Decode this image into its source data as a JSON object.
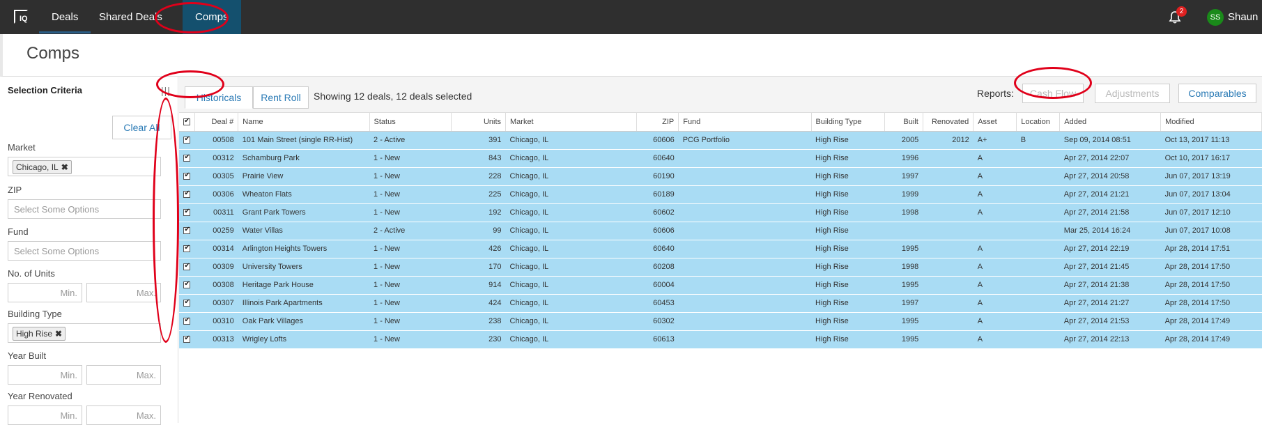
{
  "nav": {
    "logo": "IQ",
    "items": [
      "Deals",
      "Shared Deals",
      "Comps"
    ],
    "notifications": "2",
    "user_initials": "SS",
    "user_name": "Shaun"
  },
  "page": {
    "title": "Comps"
  },
  "sidebar": {
    "title": "Selection Criteria",
    "clear_all": "Clear All",
    "market_label": "Market",
    "market_tag": "Chicago, IL",
    "zip_label": "ZIP",
    "zip_placeholder": "Select Some Options",
    "fund_label": "Fund",
    "fund_placeholder": "Select Some Options",
    "units_label": "No. of Units",
    "building_type_label": "Building Type",
    "building_type_tag": "High Rise",
    "year_built_label": "Year Built",
    "year_renovated_label": "Year Renovated",
    "min": "Min.",
    "max": "Max."
  },
  "toolbar": {
    "tab_historicals": "Historicals",
    "tab_rent_roll": "Rent Roll",
    "showing": "Showing 12 deals, 12 deals selected",
    "reports_label": "Reports:",
    "cash_flow": "Cash Flow",
    "adjustments": "Adjustments",
    "comparables": "Comparables"
  },
  "table": {
    "columns": [
      "Deal #",
      "Name",
      "Status",
      "Units",
      "Market",
      "ZIP",
      "Fund",
      "Building Type",
      "Built",
      "Renovated",
      "Asset",
      "Location",
      "Added",
      "Modified"
    ],
    "rows": [
      [
        "00508",
        "101 Main Street (single RR-Hist)",
        "2 - Active",
        "391",
        "Chicago, IL",
        "60606",
        "PCG Portfolio",
        "High Rise",
        "2005",
        "2012",
        "A+",
        "B",
        "Sep 09, 2014 08:51",
        "Oct 13, 2017 11:13"
      ],
      [
        "00312",
        "Schamburg Park",
        "1 - New",
        "843",
        "Chicago, IL",
        "60640",
        "",
        "High Rise",
        "1996",
        "",
        "A",
        "",
        "Apr 27, 2014 22:07",
        "Oct 10, 2017 16:17"
      ],
      [
        "00305",
        "Prairie View",
        "1 - New",
        "228",
        "Chicago, IL",
        "60190",
        "",
        "High Rise",
        "1997",
        "",
        "A",
        "",
        "Apr 27, 2014 20:58",
        "Jun 07, 2017 13:19"
      ],
      [
        "00306",
        "Wheaton Flats",
        "1 - New",
        "225",
        "Chicago, IL",
        "60189",
        "",
        "High Rise",
        "1999",
        "",
        "A",
        "",
        "Apr 27, 2014 21:21",
        "Jun 07, 2017 13:04"
      ],
      [
        "00311",
        "Grant Park Towers",
        "1 - New",
        "192",
        "Chicago, IL",
        "60602",
        "",
        "High Rise",
        "1998",
        "",
        "A",
        "",
        "Apr 27, 2014 21:58",
        "Jun 07, 2017 12:10"
      ],
      [
        "00259",
        "Water Villas",
        "2 - Active",
        "99",
        "Chicago, IL",
        "60606",
        "",
        "High Rise",
        "",
        "",
        "",
        "",
        "Mar 25, 2014 16:24",
        "Jun 07, 2017 10:08"
      ],
      [
        "00314",
        "Arlington Heights Towers",
        "1 - New",
        "426",
        "Chicago, IL",
        "60640",
        "",
        "High Rise",
        "1995",
        "",
        "A",
        "",
        "Apr 27, 2014 22:19",
        "Apr 28, 2014 17:51"
      ],
      [
        "00309",
        "University Towers",
        "1 - New",
        "170",
        "Chicago, IL",
        "60208",
        "",
        "High Rise",
        "1998",
        "",
        "A",
        "",
        "Apr 27, 2014 21:45",
        "Apr 28, 2014 17:50"
      ],
      [
        "00308",
        "Heritage Park House",
        "1 - New",
        "914",
        "Chicago, IL",
        "60004",
        "",
        "High Rise",
        "1995",
        "",
        "A",
        "",
        "Apr 27, 2014 21:38",
        "Apr 28, 2014 17:50"
      ],
      [
        "00307",
        "Illinois Park Apartments",
        "1 - New",
        "424",
        "Chicago, IL",
        "60453",
        "",
        "High Rise",
        "1997",
        "",
        "A",
        "",
        "Apr 27, 2014 21:27",
        "Apr 28, 2014 17:50"
      ],
      [
        "00310",
        "Oak Park Villages",
        "1 - New",
        "238",
        "Chicago, IL",
        "60302",
        "",
        "High Rise",
        "1995",
        "",
        "A",
        "",
        "Apr 27, 2014 21:53",
        "Apr 28, 2014 17:49"
      ],
      [
        "00313",
        "Wrigley Lofts",
        "1 - New",
        "230",
        "Chicago, IL",
        "60613",
        "",
        "High Rise",
        "1995",
        "",
        "A",
        "",
        "Apr 27, 2014 22:13",
        "Apr 28, 2014 17:49"
      ]
    ]
  },
  "colors": {
    "nav_bg": "#2f2f2f",
    "active_tab": "#14506e",
    "row_selected": "#a9dcf4",
    "link": "#2a7ab5",
    "annotation": "#e0001a"
  }
}
